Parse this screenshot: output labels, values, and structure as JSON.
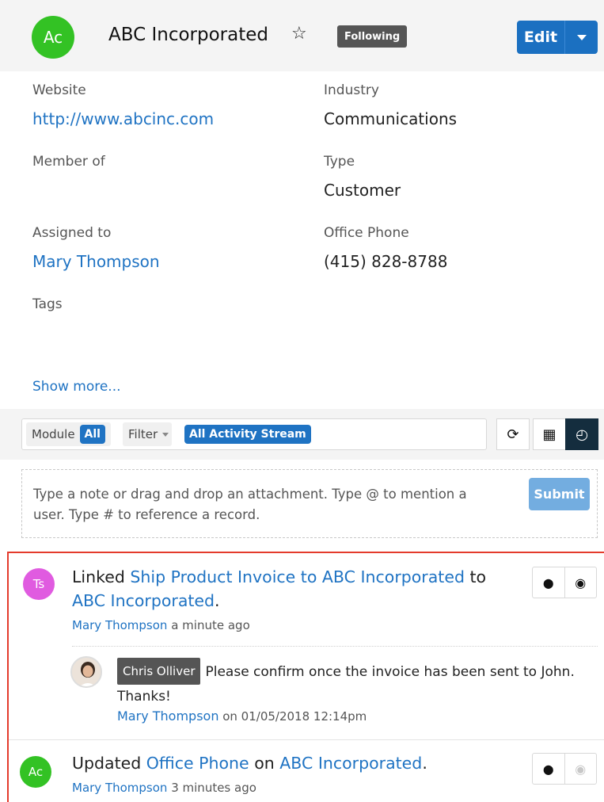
{
  "top_link": {
    "text": ""
  },
  "record": {
    "avatar_initials": "Ac",
    "name": "ABC Incorporated",
    "favorite_icon": "star-outline-icon",
    "following_badge": "Following",
    "edit_label": "Edit"
  },
  "fields": {
    "website": {
      "label": "Website",
      "value": "http://www.abcinc.com"
    },
    "industry": {
      "label": "Industry",
      "value": "Communications"
    },
    "member_of": {
      "label": "Member of",
      "value": ""
    },
    "type": {
      "label": "Type",
      "value": "Customer"
    },
    "assigned_to": {
      "label": "Assigned to",
      "value": "Mary Thompson"
    },
    "office_phone": {
      "label": "Office Phone",
      "value": "(415) 828-8788"
    },
    "tags": {
      "label": "Tags",
      "value": ""
    },
    "show_more": "Show more..."
  },
  "activity_toolbar": {
    "module_label": "Module",
    "module_value": "All",
    "filter_label": "Filter",
    "filter_value": "All Activity Stream",
    "refresh_icon": "refresh-icon",
    "list_view_icon": "table-icon",
    "activity_view_icon": "clock-icon"
  },
  "note": {
    "placeholder": "Type a note or drag and drop an attachment. Type @ to mention a user. Type # to reference a record.",
    "submit_label": "Submit"
  },
  "feed": [
    {
      "avatar_initials": "Ts",
      "avatar_color": "#e05be0",
      "verb": "Linked",
      "link1": "Ship Product Invoice to ABC Incorporated",
      "connector": "to",
      "link2": "ABC Incorporated",
      "end": ".",
      "author": "Mary Thompson",
      "time": "a minute ago",
      "comment": {
        "mention": "Chris Olliver",
        "text": "Please confirm once the invoice has been sent to John. Thanks!",
        "author": "Mary Thompson",
        "time": "on 01/05/2018 12:14pm"
      }
    },
    {
      "avatar_initials": "Ac",
      "avatar_color": "#33c224",
      "verb": "Updated",
      "link1": "Office Phone",
      "connector": "on",
      "link2": "ABC Incorporated",
      "end": ".",
      "author": "Mary Thompson",
      "time": "3 minutes ago"
    }
  ],
  "colors": {
    "accent": "#1f73c3",
    "highlight_border": "#e43b2c",
    "header_bg": "#f4f4f4"
  }
}
